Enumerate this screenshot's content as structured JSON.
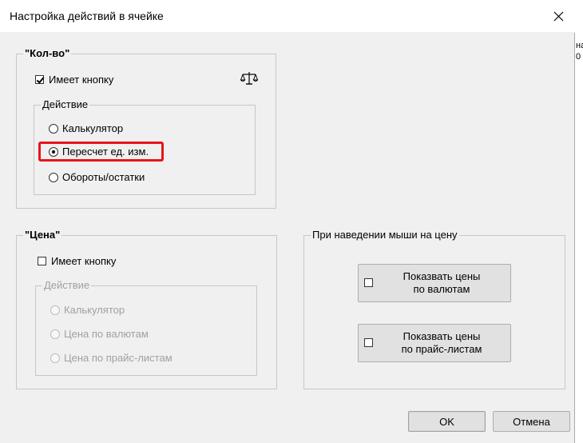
{
  "dialog": {
    "title": "Настройка действий в ячейке",
    "behind_text": "на\n0"
  },
  "qty_group": {
    "legend": "\"Кол-во\"",
    "has_button_label": "Имеет кнопку",
    "has_button_checked": true,
    "action_legend": "Действие",
    "options": [
      "Калькулятор",
      "Пересчет ед. изм.",
      "Обороты/остатки"
    ],
    "selected_index": 1
  },
  "price_group": {
    "legend": "\"Цена\"",
    "has_button_label": "Имеет кнопку",
    "has_button_checked": false,
    "action_legend": "Действие",
    "options": [
      "Калькулятор",
      "Цена по валютам",
      "Цена по прайс-листам"
    ]
  },
  "hover_group": {
    "legend": "При наведении мыши на цену",
    "buttons": [
      {
        "line1": "Показвать цены",
        "line2": "по валютам"
      },
      {
        "line1": "Показвать цены",
        "line2": "по прайс-листам"
      }
    ]
  },
  "footer": {
    "ok_label": "OK",
    "cancel_label": "Отмена"
  },
  "colors": {
    "dialog_bg": "#f0f0f0",
    "highlight": "#e8141b",
    "disabled_text": "#a0a0a0"
  }
}
